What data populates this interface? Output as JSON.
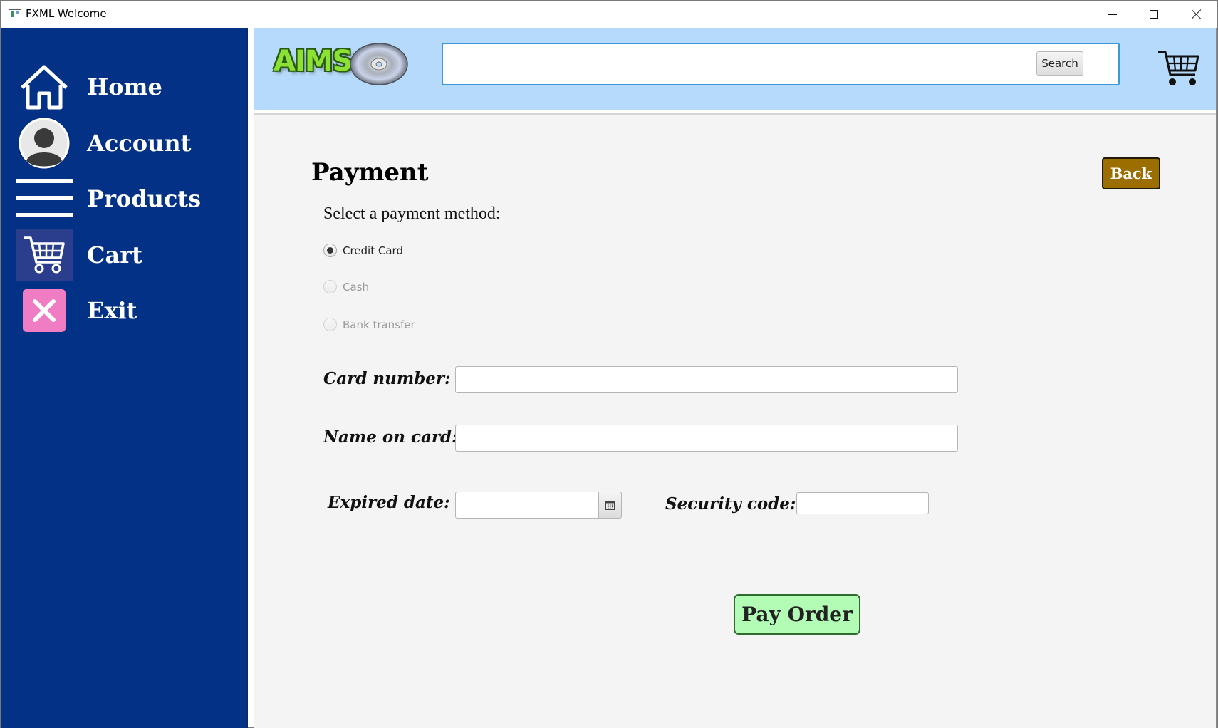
{
  "window": {
    "title": "FXML Welcome"
  },
  "sidebar": {
    "items": [
      {
        "label": "Home",
        "icon": "home-icon"
      },
      {
        "label": "Account",
        "icon": "user-icon"
      },
      {
        "label": "Products",
        "icon": "menu-icon"
      },
      {
        "label": "Cart",
        "icon": "cart-icon",
        "active": true
      },
      {
        "label": "Exit",
        "icon": "close-icon"
      }
    ]
  },
  "header": {
    "logo_text": "AIMS",
    "search": {
      "value": "",
      "placeholder": "",
      "button_label": "Search"
    }
  },
  "payment": {
    "title": "Payment",
    "back_label": "Back",
    "select_label": "Select a payment method:",
    "methods": [
      {
        "label": "Credit Card",
        "selected": true,
        "enabled": true
      },
      {
        "label": "Cash",
        "selected": false,
        "enabled": false
      },
      {
        "label": "Bank transfer",
        "selected": false,
        "enabled": false
      }
    ],
    "fields": {
      "card_number_label": "Card number:",
      "card_number_value": "",
      "name_label": "Name on card:",
      "name_value": "",
      "expired_label": "Expired date:",
      "expired_value": "",
      "security_label": "Security code:",
      "security_value": ""
    },
    "pay_label": "Pay Order"
  },
  "colors": {
    "sidebar_bg": "#023185",
    "header_bg": "#b6dafb",
    "content_bg": "#f4f4f4",
    "back_button": "#9c6e00",
    "pay_button": "#b3fcb5",
    "exit_icon_bg": "#f07cc4"
  }
}
